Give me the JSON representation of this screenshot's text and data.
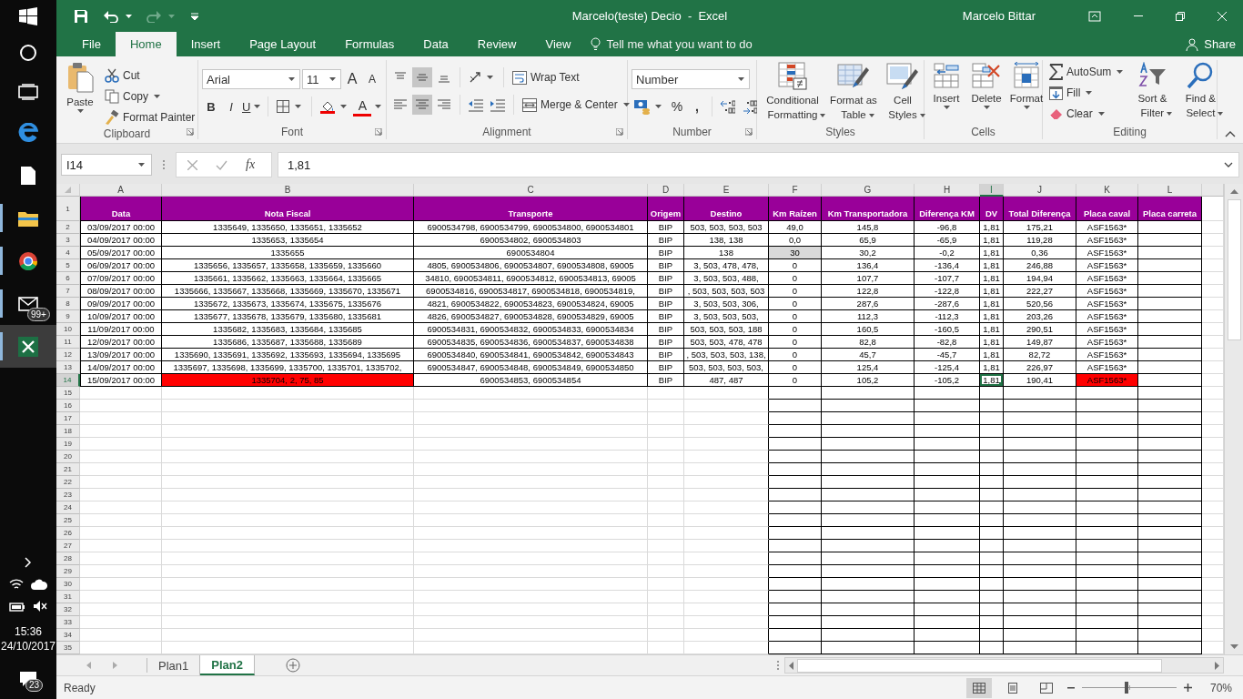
{
  "window": {
    "title": "Marcelo(teste) Decio  -  Excel",
    "user": "Marcelo Bittar"
  },
  "taskbar": {
    "apps": [
      {
        "kind": "start",
        "running": false,
        "active": false
      },
      {
        "kind": "cortana",
        "running": false,
        "active": false
      },
      {
        "kind": "taskview",
        "running": false,
        "active": false
      },
      {
        "kind": "edge",
        "running": false,
        "active": false
      },
      {
        "kind": "file",
        "running": false,
        "active": false
      },
      {
        "kind": "explorer",
        "running": true,
        "active": false
      },
      {
        "kind": "chrome",
        "running": true,
        "active": false
      },
      {
        "kind": "mail",
        "running": true,
        "active": false,
        "badge": "99+"
      },
      {
        "kind": "excel",
        "running": true,
        "active": true
      }
    ],
    "clock": "15:36",
    "date": "24/10/2017",
    "notifications": "23"
  },
  "tabs": [
    {
      "label": "File",
      "selected": false
    },
    {
      "label": "Home",
      "selected": true
    },
    {
      "label": "Insert",
      "selected": false
    },
    {
      "label": "Page Layout",
      "selected": false
    },
    {
      "label": "Formulas",
      "selected": false
    },
    {
      "label": "Data",
      "selected": false
    },
    {
      "label": "Review",
      "selected": false
    },
    {
      "label": "View",
      "selected": false
    }
  ],
  "tell_me": "Tell me what you want to do",
  "share": "Share",
  "ribbon": {
    "groups": [
      {
        "kind": "clipboard",
        "label": "Clipboard",
        "buttons": [
          "Paste",
          "Cut",
          "Copy",
          "Format Painter"
        ]
      },
      {
        "kind": "font",
        "label": "Font",
        "font": "Arial",
        "size": "11",
        "grow": "A",
        "shrink": "A",
        "bold": "B",
        "italic": "I",
        "underline": "U",
        "font_color": "A"
      },
      {
        "kind": "alignment",
        "label": "Alignment",
        "vertical": [
          {
            "selected": false
          },
          {
            "selected": true
          },
          {
            "selected": false
          }
        ],
        "horizontal": [
          {
            "selected": false
          },
          {
            "selected": true
          },
          {
            "selected": false
          }
        ],
        "buttons": [
          "Wrap Text",
          "Merge & Center"
        ]
      },
      {
        "kind": "number",
        "label": "Number",
        "format": "Number",
        "percent": "%",
        "comma": ","
      },
      {
        "kind": "styles",
        "label": "Styles",
        "buttons": [
          "Conditional Formatting",
          "Format as Table",
          "Cell Styles"
        ]
      },
      {
        "kind": "cells",
        "label": "Cells",
        "buttons": [
          "Insert",
          "Delete",
          "Format"
        ]
      },
      {
        "kind": "editing",
        "label": "Editing",
        "buttons": [
          "AutoSum",
          "Fill",
          "Clear",
          "Sort & Filter",
          "Find & Select"
        ]
      }
    ]
  },
  "formula_bar": {
    "name_box": "I14",
    "fx": "fx",
    "value": "1,81"
  },
  "sheet": {
    "columns": [
      {
        "label": "A",
        "selected": false
      },
      {
        "label": "B",
        "selected": false
      },
      {
        "label": "C",
        "selected": false
      },
      {
        "label": "D",
        "selected": false
      },
      {
        "label": "E",
        "selected": false
      },
      {
        "label": "F",
        "selected": false
      },
      {
        "label": "G",
        "selected": false
      },
      {
        "label": "H",
        "selected": false
      },
      {
        "label": "I",
        "selected": true
      },
      {
        "label": "J",
        "selected": false
      },
      {
        "label": "K",
        "selected": false
      },
      {
        "label": "L",
        "selected": false
      }
    ],
    "rows": [
      {
        "number": "1",
        "selected": false,
        "kind": "header",
        "cells": [
          "Data",
          "Nota Fiscal",
          "Transporte",
          "Origem",
          "Destino",
          "Km Raízen",
          "Km Transportadora",
          "Diferença KM",
          "DV",
          "Total Diferença",
          "Placa caval",
          "Placa carreta"
        ]
      },
      {
        "number": "2",
        "selected": false,
        "kind": "data",
        "cells": [
          "03/09/2017 00:00",
          "1335649, 1335650, 1335651, 1335652",
          "6900534798, 6900534799, 6900534800, 6900534801",
          "BIP",
          "503, 503, 503, 503",
          "49,0",
          "145,8",
          "-96,8",
          "1,81",
          "175,21",
          "ASF1563*"
        ]
      },
      {
        "number": "3",
        "selected": false,
        "kind": "data",
        "cells": [
          "04/09/2017 00:00",
          "1335653, 1335654",
          "6900534802, 6900534803",
          "BIP",
          "138, 138",
          "0,0",
          "65,9",
          "-65,9",
          "1,81",
          "119,28",
          "ASF1563*"
        ]
      },
      {
        "number": "4",
        "selected": false,
        "kind": "data",
        "cells": [
          "05/09/2017 00:00",
          "1335655",
          "6900534804",
          "BIP",
          "138",
          {
            "text": "30",
            "color": "#d9d9d9"
          },
          "30,2",
          "-0,2",
          "1,81",
          "0,36",
          "ASF1563*"
        ]
      },
      {
        "number": "5",
        "selected": false,
        "kind": "data",
        "cells": [
          "06/09/2017 00:00",
          "1335656, 1335657, 1335658, 1335659, 1335660",
          "4805, 6900534806, 6900534807, 6900534808, 69005",
          "BIP",
          "3, 503, 478, 478,",
          "0",
          "136,4",
          "-136,4",
          "1,81",
          "246,88",
          "ASF1563*"
        ]
      },
      {
        "number": "6",
        "selected": false,
        "kind": "data",
        "cells": [
          "07/09/2017 00:00",
          "1335661, 1335662, 1335663, 1335664, 1335665",
          "34810, 6900534811, 6900534812, 6900534813, 69005",
          "BIP",
          "3, 503, 503, 488,",
          "0",
          "107,7",
          "-107,7",
          "1,81",
          "194,94",
          "ASF1563*"
        ]
      },
      {
        "number": "7",
        "selected": false,
        "kind": "data",
        "cells": [
          "08/09/2017 00:00",
          "1335666, 1335667, 1335668, 1335669, 1335670, 1335671",
          "6900534816, 6900534817, 6900534818, 6900534819,",
          "BIP",
          ", 503, 503, 503, 503",
          "0",
          "122,8",
          "-122,8",
          "1,81",
          "222,27",
          "ASF1563*"
        ]
      },
      {
        "number": "8",
        "selected": false,
        "kind": "data",
        "cells": [
          "09/09/2017 00:00",
          "1335672, 1335673, 1335674, 1335675, 1335676",
          "4821, 6900534822, 6900534823, 6900534824, 69005",
          "BIP",
          "3, 503, 503, 306,",
          "0",
          "287,6",
          "-287,6",
          "1,81",
          "520,56",
          "ASF1563*"
        ]
      },
      {
        "number": "9",
        "selected": false,
        "kind": "data",
        "cells": [
          "10/09/2017 00:00",
          "1335677, 1335678, 1335679, 1335680, 1335681",
          "4826, 6900534827, 6900534828, 6900534829, 69005",
          "BIP",
          "3, 503, 503, 503,",
          "0",
          "112,3",
          "-112,3",
          "1,81",
          "203,26",
          "ASF1563*"
        ]
      },
      {
        "number": "10",
        "selected": false,
        "kind": "data",
        "cells": [
          "11/09/2017 00:00",
          "1335682, 1335683, 1335684, 1335685",
          "6900534831, 6900534832, 6900534833, 6900534834",
          "BIP",
          "503, 503, 503, 188",
          "0",
          "160,5",
          "-160,5",
          "1,81",
          "290,51",
          "ASF1563*"
        ]
      },
      {
        "number": "11",
        "selected": false,
        "kind": "data",
        "cells": [
          "12/09/2017 00:00",
          "1335686, 1335687, 1335688, 1335689",
          "6900534835, 6900534836, 6900534837, 6900534838",
          "BIP",
          "503, 503, 478, 478",
          "0",
          "82,8",
          "-82,8",
          "1,81",
          "149,87",
          "ASF1563*"
        ]
      },
      {
        "number": "12",
        "selected": false,
        "kind": "data",
        "cells": [
          "13/09/2017 00:00",
          "1335690, 1335691, 1335692, 1335693, 1335694, 1335695",
          "6900534840, 6900534841, 6900534842, 6900534843",
          "BIP",
          ", 503, 503, 503, 138,",
          "0",
          "45,7",
          "-45,7",
          "1,81",
          "82,72",
          "ASF1563*"
        ]
      },
      {
        "number": "13",
        "selected": false,
        "kind": "data",
        "cells": [
          "14/09/2017 00:00",
          "1335697, 1335698, 1335699, 1335700, 1335701, 1335702,",
          "6900534847, 6900534848, 6900534849, 6900534850",
          "BIP",
          "503, 503, 503, 503,",
          "0",
          "125,4",
          "-125,4",
          "1,81",
          "226,97",
          "ASF1563*"
        ]
      },
      {
        "number": "14",
        "selected": true,
        "kind": "data",
        "cells": [
          "15/09/2017 00:00",
          {
            "text": "1335704, 2, 75, 85",
            "color": "#ff0000"
          },
          "6900534853, 6900534854",
          "BIP",
          "487, 487",
          "0",
          "105,2",
          "-105,2",
          "1,81",
          "190,41",
          {
            "text": "ASF1563*",
            "color": "#ff0000"
          }
        ]
      },
      {
        "number": "15",
        "selected": false
      },
      {
        "number": "16",
        "selected": false
      },
      {
        "number": "17",
        "selected": false
      },
      {
        "number": "18",
        "selected": false
      },
      {
        "number": "19",
        "selected": false
      },
      {
        "number": "20",
        "selected": false
      },
      {
        "number": "21",
        "selected": false
      },
      {
        "number": "22",
        "selected": false
      },
      {
        "number": "23",
        "selected": false
      },
      {
        "number": "24",
        "selected": false
      },
      {
        "number": "25",
        "selected": false
      },
      {
        "number": "26",
        "selected": false
      },
      {
        "number": "27",
        "selected": false
      },
      {
        "number": "28",
        "selected": false
      },
      {
        "number": "29",
        "selected": false
      },
      {
        "number": "30",
        "selected": false
      },
      {
        "number": "31",
        "selected": false
      },
      {
        "number": "32",
        "selected": false
      },
      {
        "number": "33",
        "selected": false
      },
      {
        "number": "34",
        "selected": false
      },
      {
        "number": "35",
        "selected": false
      }
    ]
  },
  "sheet_tabs": [
    {
      "label": "Plan1",
      "selected": false
    },
    {
      "label": "Plan2",
      "selected": true
    }
  ],
  "status_bar": {
    "status": "Ready",
    "views": [
      {
        "selected": true
      },
      {
        "selected": false
      },
      {
        "selected": false
      }
    ],
    "zoom_slider": {
      "level": 0.47
    },
    "zoom": "70%"
  }
}
